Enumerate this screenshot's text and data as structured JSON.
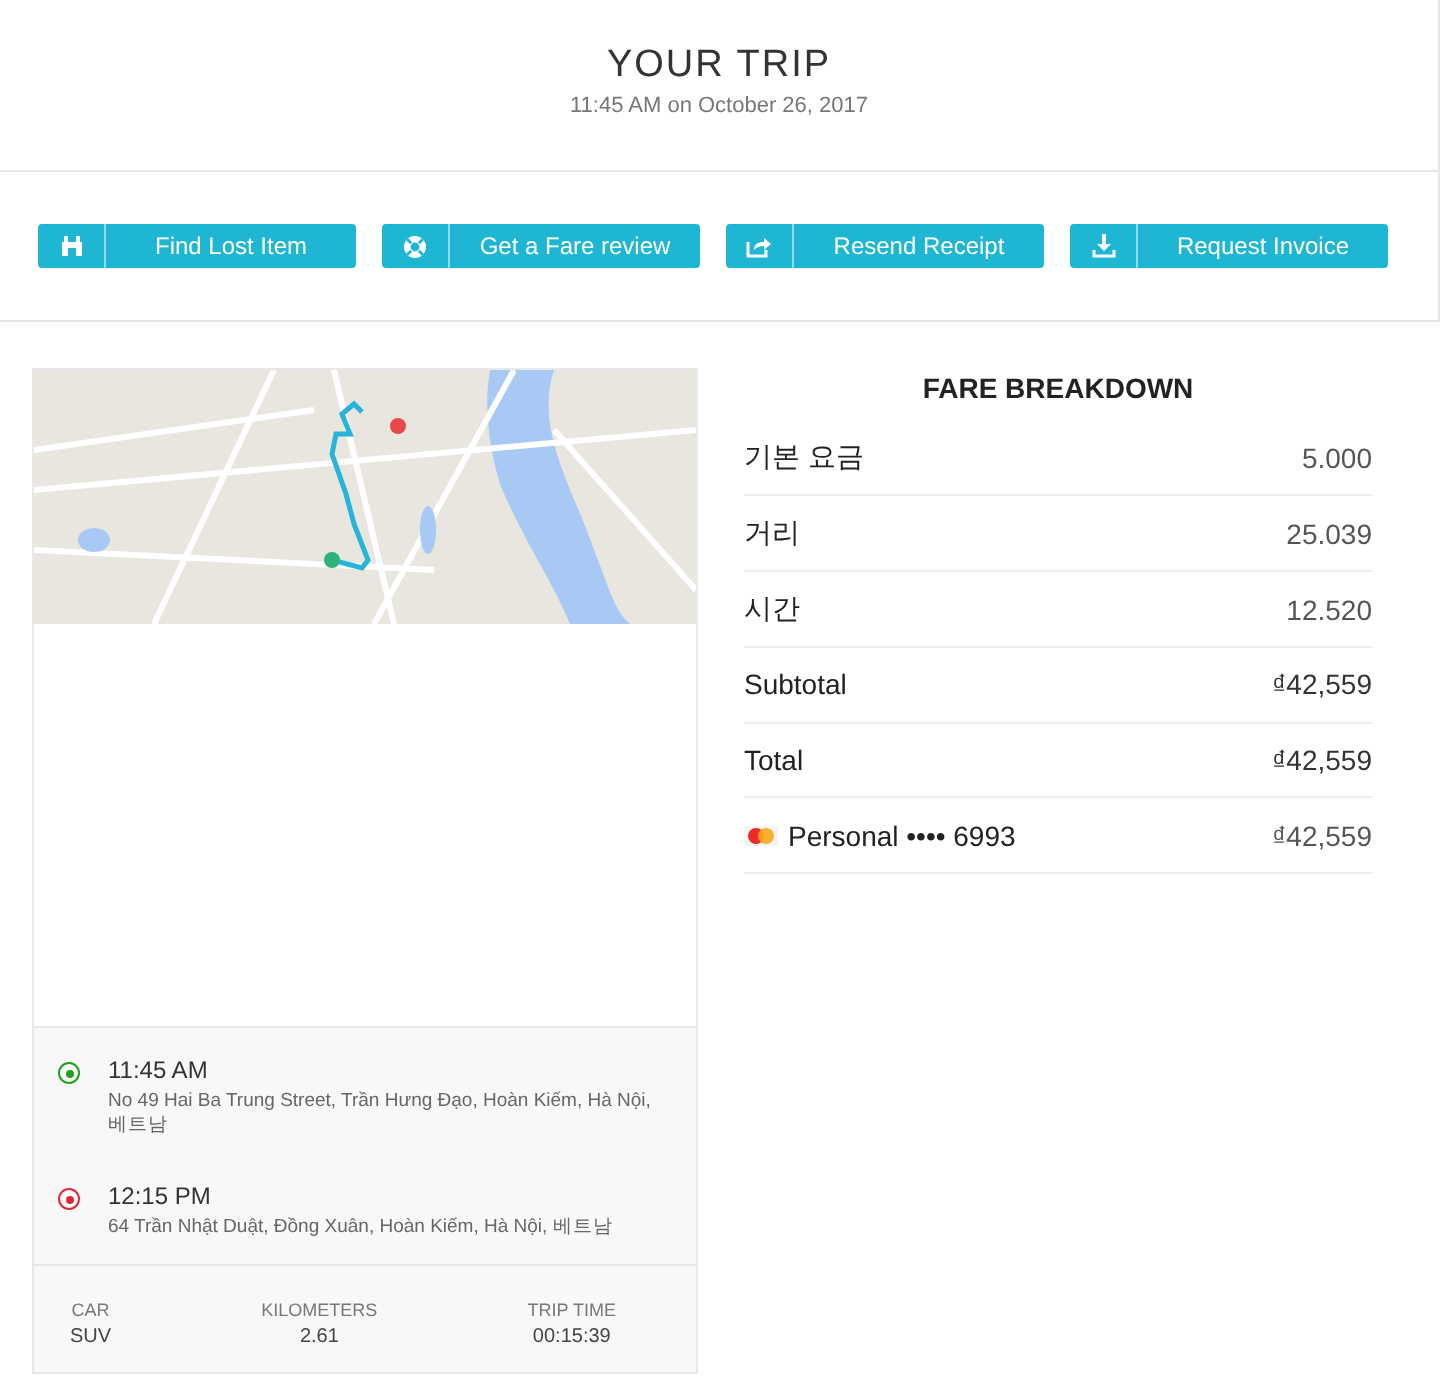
{
  "header": {
    "title": "YOUR TRIP",
    "subtitle": "11:45 AM on October 26, 2017"
  },
  "actions": [
    {
      "kind": "binoculars",
      "label": "Find Lost Item"
    },
    {
      "kind": "lifebuoy",
      "label": "Get a Fare review"
    },
    {
      "kind": "share",
      "label": "Resend Receipt"
    },
    {
      "kind": "download",
      "label": "Request Invoice"
    }
  ],
  "trip": {
    "stops": [
      {
        "kind": "pickup",
        "time": "11:45 AM",
        "address": "No 49 Hai Ba Trung Street, Trần Hưng Đạo, Hoàn Kiếm, Hà Nội, 베트남"
      },
      {
        "kind": "dropoff",
        "time": "12:15 PM",
        "address": "64 Trần Nhật Duật, Đồng Xuân, Hoàn Kiếm, Hà Nội, 베트남"
      }
    ],
    "stats": [
      {
        "label": "CAR",
        "value": "SUV"
      },
      {
        "label": "KILOMETERS",
        "value": "2.61"
      },
      {
        "label": "TRIP TIME",
        "value": "00:15:39"
      }
    ]
  },
  "fare": {
    "title": "FARE BREAKDOWN",
    "rows": [
      {
        "kind": "line",
        "label": "기본 요금",
        "amount": "5.000"
      },
      {
        "kind": "line",
        "label": "거리",
        "amount": "25.039"
      },
      {
        "kind": "line",
        "label": "시간",
        "amount": "12.520"
      },
      {
        "kind": "total",
        "label": "Subtotal",
        "amount": "₫42,559"
      },
      {
        "kind": "total",
        "label": "Total",
        "amount": "₫42,559"
      },
      {
        "kind": "payment",
        "label": "Personal •••• 6993",
        "amount": "₫42,559"
      }
    ]
  }
}
